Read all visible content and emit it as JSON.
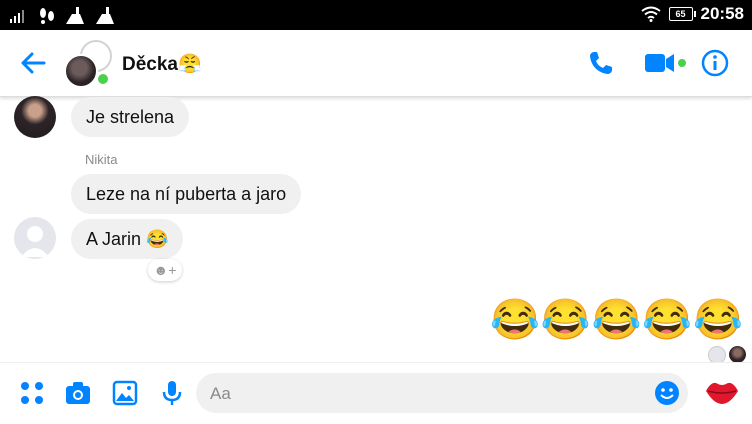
{
  "status_bar": {
    "time": "20:58",
    "battery": "65"
  },
  "header": {
    "title": "Děcka😤"
  },
  "messages": [
    {
      "text": "Je strelena"
    },
    {
      "sender": "Nikita",
      "text": "Leze na ní puberta a jaro"
    },
    {
      "text": "A Jarin 😂"
    }
  ],
  "reaction_button": "☻+",
  "sent_emojis": "😂😂😂😂😂",
  "composer": {
    "placeholder": "Aa"
  },
  "colors": {
    "accent": "#0084ff",
    "bubble": "#f0f0f0",
    "online": "#4bd04b"
  }
}
